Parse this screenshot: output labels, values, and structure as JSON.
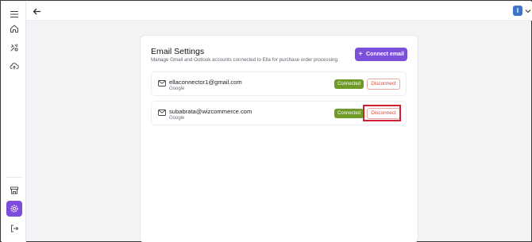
{
  "sidebar": {
    "items": [
      {
        "icon": "menu-icon"
      },
      {
        "icon": "home-icon"
      },
      {
        "icon": "tools-icon"
      },
      {
        "icon": "upload-cloud-icon"
      },
      {
        "icon": "store-icon"
      },
      {
        "icon": "gear-icon",
        "active": true
      },
      {
        "icon": "logout-icon"
      }
    ],
    "accent": "#7c4ddc"
  },
  "topbar": {
    "back_icon": "arrow-left-icon",
    "avatar_initial": "I",
    "avatar_color": "#3b74c9"
  },
  "settings": {
    "title": "Email Settings",
    "subtitle": "Manage Gmail and Outlook accounts connected to Ella for purchase order processing.",
    "connect_label": "Connect email",
    "accounts": [
      {
        "email": "ellaconnector1@gmail.com",
        "provider": "Google",
        "status": "Connected",
        "action": "Disconnect"
      },
      {
        "email": "subabrata@wizcommerce.com",
        "provider": "Google",
        "status": "Connected",
        "action": "Disconnect"
      }
    ]
  },
  "colors": {
    "connected_badge": "#6f9a27",
    "disconnect_text": "#d4493b",
    "highlight": "#d21f2f"
  }
}
